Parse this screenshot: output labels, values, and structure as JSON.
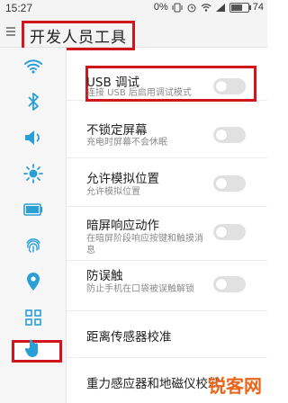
{
  "status_bar": {
    "time": "15:27",
    "network_speed": "0%",
    "battery_level": "74",
    "battery_fraction": 0.74
  },
  "header": {
    "title": "开发人员工具"
  },
  "sidebar": {
    "items": [
      {
        "icon": "wifi-icon"
      },
      {
        "icon": "bluetooth-icon"
      },
      {
        "icon": "sound-icon"
      },
      {
        "icon": "brightness-icon"
      },
      {
        "icon": "battery-icon"
      },
      {
        "icon": "fingerprint-icon"
      },
      {
        "icon": "location-icon"
      },
      {
        "icon": "apps-grid-icon"
      },
      {
        "icon": "hand-icon",
        "selected": true
      }
    ]
  },
  "settings": [
    {
      "title": "USB 调试",
      "subtitle": "连接 USB 后启用调试模式",
      "toggle": false
    },
    {
      "title": "不锁定屏幕",
      "subtitle": "充电时屏幕不会休眠",
      "toggle": false
    },
    {
      "title": "允许模拟位置",
      "subtitle": "允许模拟位置",
      "toggle": false
    },
    {
      "title": "暗屏响应动作",
      "subtitle": "在暗屏阶段响应按键和触摸消息",
      "toggle": false
    },
    {
      "title": "防误触",
      "subtitle": "防止手机在口袋被误触解锁",
      "toggle": false
    },
    {
      "title": "距离传感器校准"
    },
    {
      "title": "重力感应器和地磁仪校准"
    }
  ],
  "watermark": "锐客网",
  "colors": {
    "highlight": "#d2151b",
    "toggle_off": "#e1e1e1",
    "accent_icon": "#2a9fd6"
  }
}
